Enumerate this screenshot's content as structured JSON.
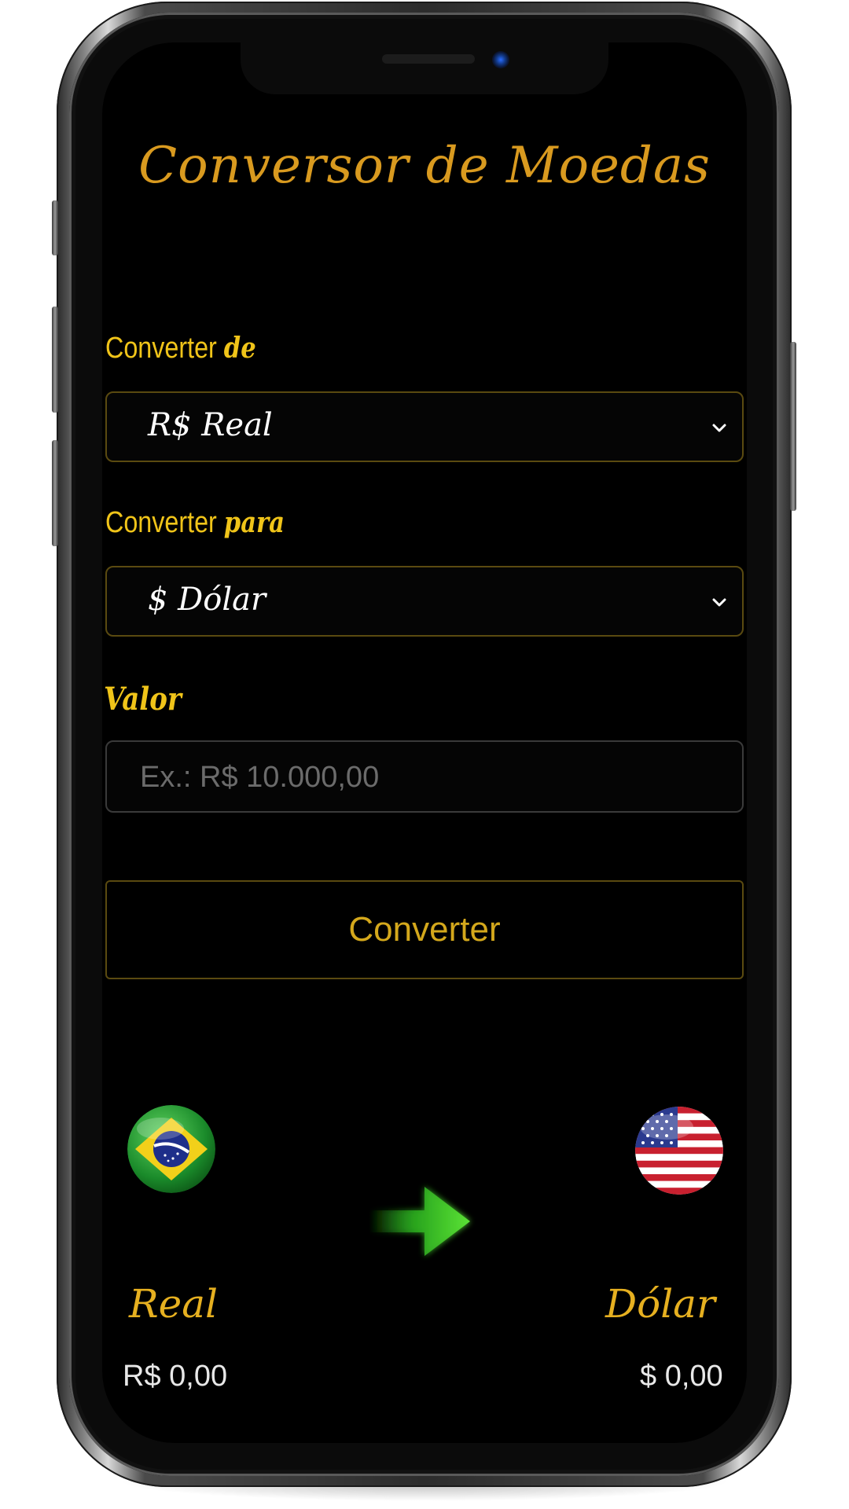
{
  "app": {
    "title": "Conversor de Moedas"
  },
  "from": {
    "label": "Converter",
    "label_script": "de",
    "selected": "R$ Real"
  },
  "to": {
    "label": "Converter",
    "label_script": "para",
    "selected": "$ Dólar"
  },
  "amount": {
    "label": "Valor",
    "placeholder": "Ex.: R$ 10.000,00",
    "value": ""
  },
  "action": {
    "convert_label": "Converter"
  },
  "result": {
    "source": {
      "name": "Real",
      "value": "R$ 0,00",
      "flag": "brazil-flag-icon"
    },
    "target": {
      "name": "Dólar",
      "value": "$ 0,00",
      "flag": "usa-flag-icon"
    },
    "arrow": "green-arrow-icon"
  },
  "colors": {
    "background": "#000000",
    "title": "#d99a1f",
    "label": "#f0c419",
    "button_text": "#d4a81c",
    "border": "#5a4a10"
  }
}
